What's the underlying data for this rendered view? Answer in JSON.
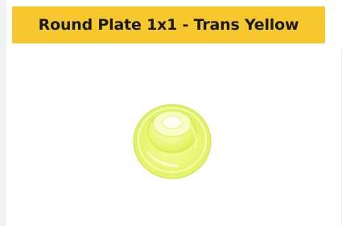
{
  "product": {
    "title": "Round Plate 1x1 - Trans Yellow",
    "part_color_name": "Trans Yellow"
  },
  "colors": {
    "title_bar_background": "#f7c82e",
    "title_text": "#1a1a1a",
    "part_fill": "#e8f76a",
    "page_background": "#ffffff"
  },
  "icons": {
    "product_image": "lego-round-plate-1x1-image"
  }
}
